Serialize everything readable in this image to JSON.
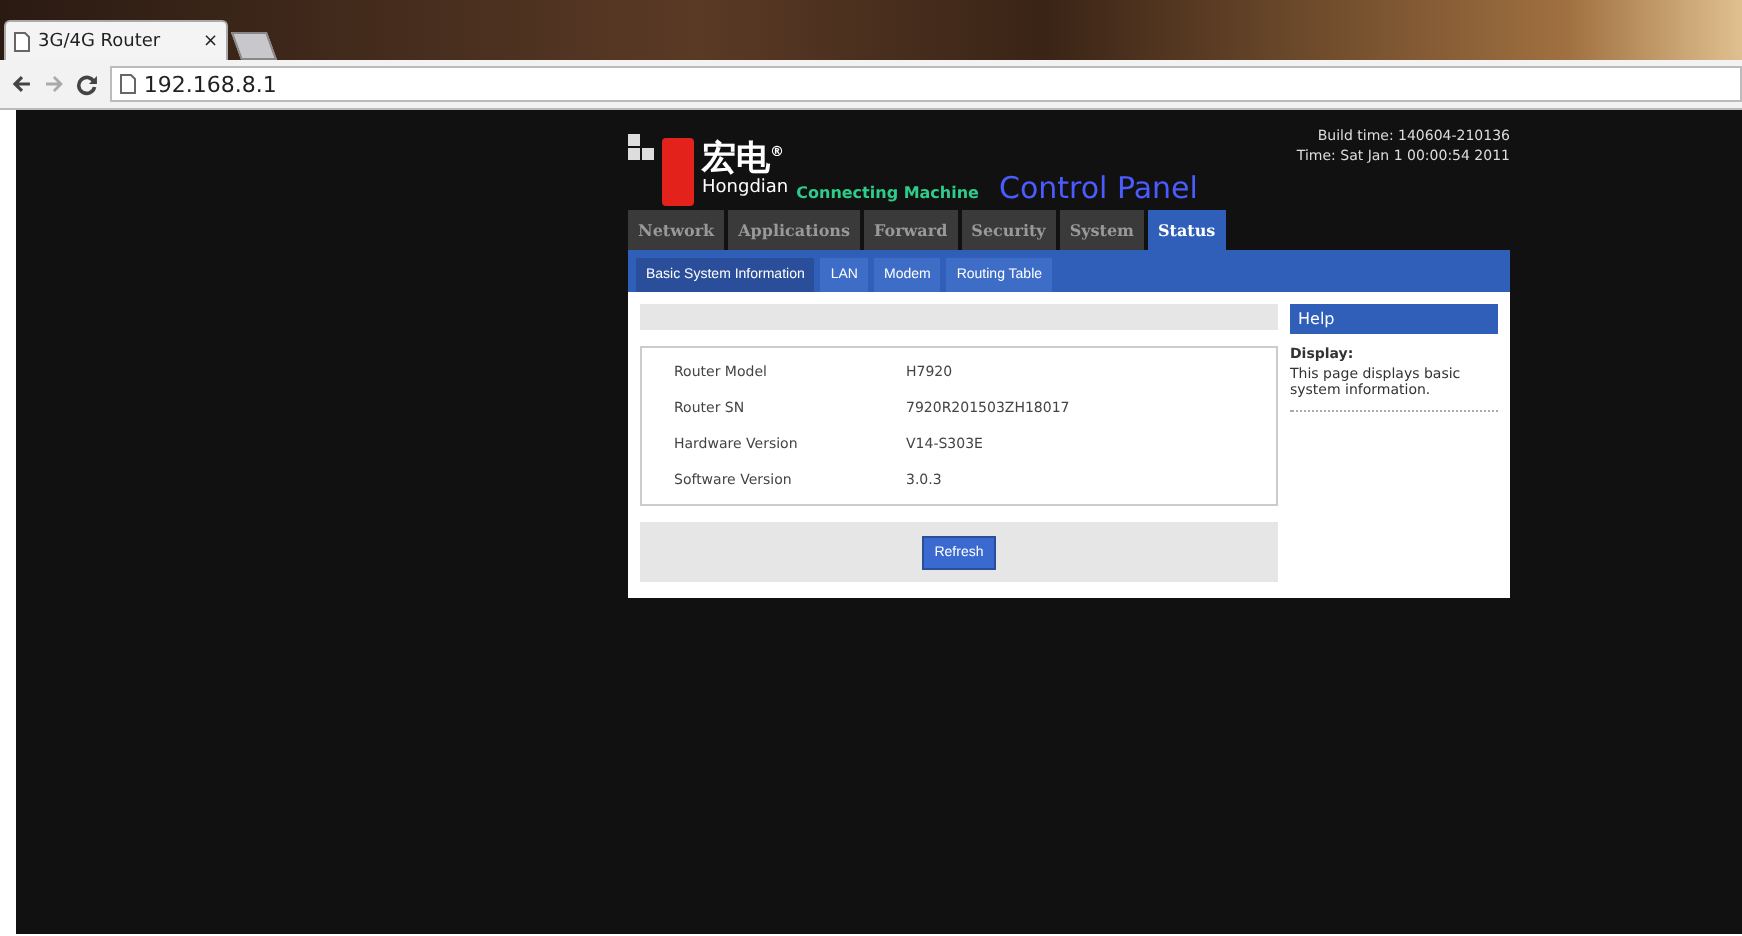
{
  "browser": {
    "tab_title": "3G/4G Router",
    "tab_close": "×",
    "address": "192.168.8.1"
  },
  "header": {
    "brand_cn": "宏电",
    "registered": "®",
    "brand_en": "Hongdian",
    "slogan": "Connecting Machine",
    "title": "Control Panel",
    "build_time": "Build time: 140604-210136",
    "time": "Time: Sat Jan 1 00:00:54 2011"
  },
  "tabs": [
    {
      "label": "Network",
      "selected": false
    },
    {
      "label": "Applications",
      "selected": false
    },
    {
      "label": "Forward",
      "selected": false
    },
    {
      "label": "Security",
      "selected": false
    },
    {
      "label": "System",
      "selected": false
    },
    {
      "label": "Status",
      "selected": true
    }
  ],
  "subtabs": [
    {
      "label": "Basic System Information",
      "selected": true
    },
    {
      "label": "LAN",
      "selected": false
    },
    {
      "label": "Modem",
      "selected": false
    },
    {
      "label": "Routing Table",
      "selected": false
    }
  ],
  "info": [
    {
      "label": "Router Model",
      "value": "H7920"
    },
    {
      "label": "Router SN",
      "value": "7920R201503ZH18017"
    },
    {
      "label": "Hardware Version",
      "value": "V14-S303E"
    },
    {
      "label": "Software Version",
      "value": "3.0.3"
    }
  ],
  "refresh_button": "Refresh",
  "help": {
    "title": "Help",
    "heading": "Display:",
    "text": "This page displays basic system information."
  }
}
